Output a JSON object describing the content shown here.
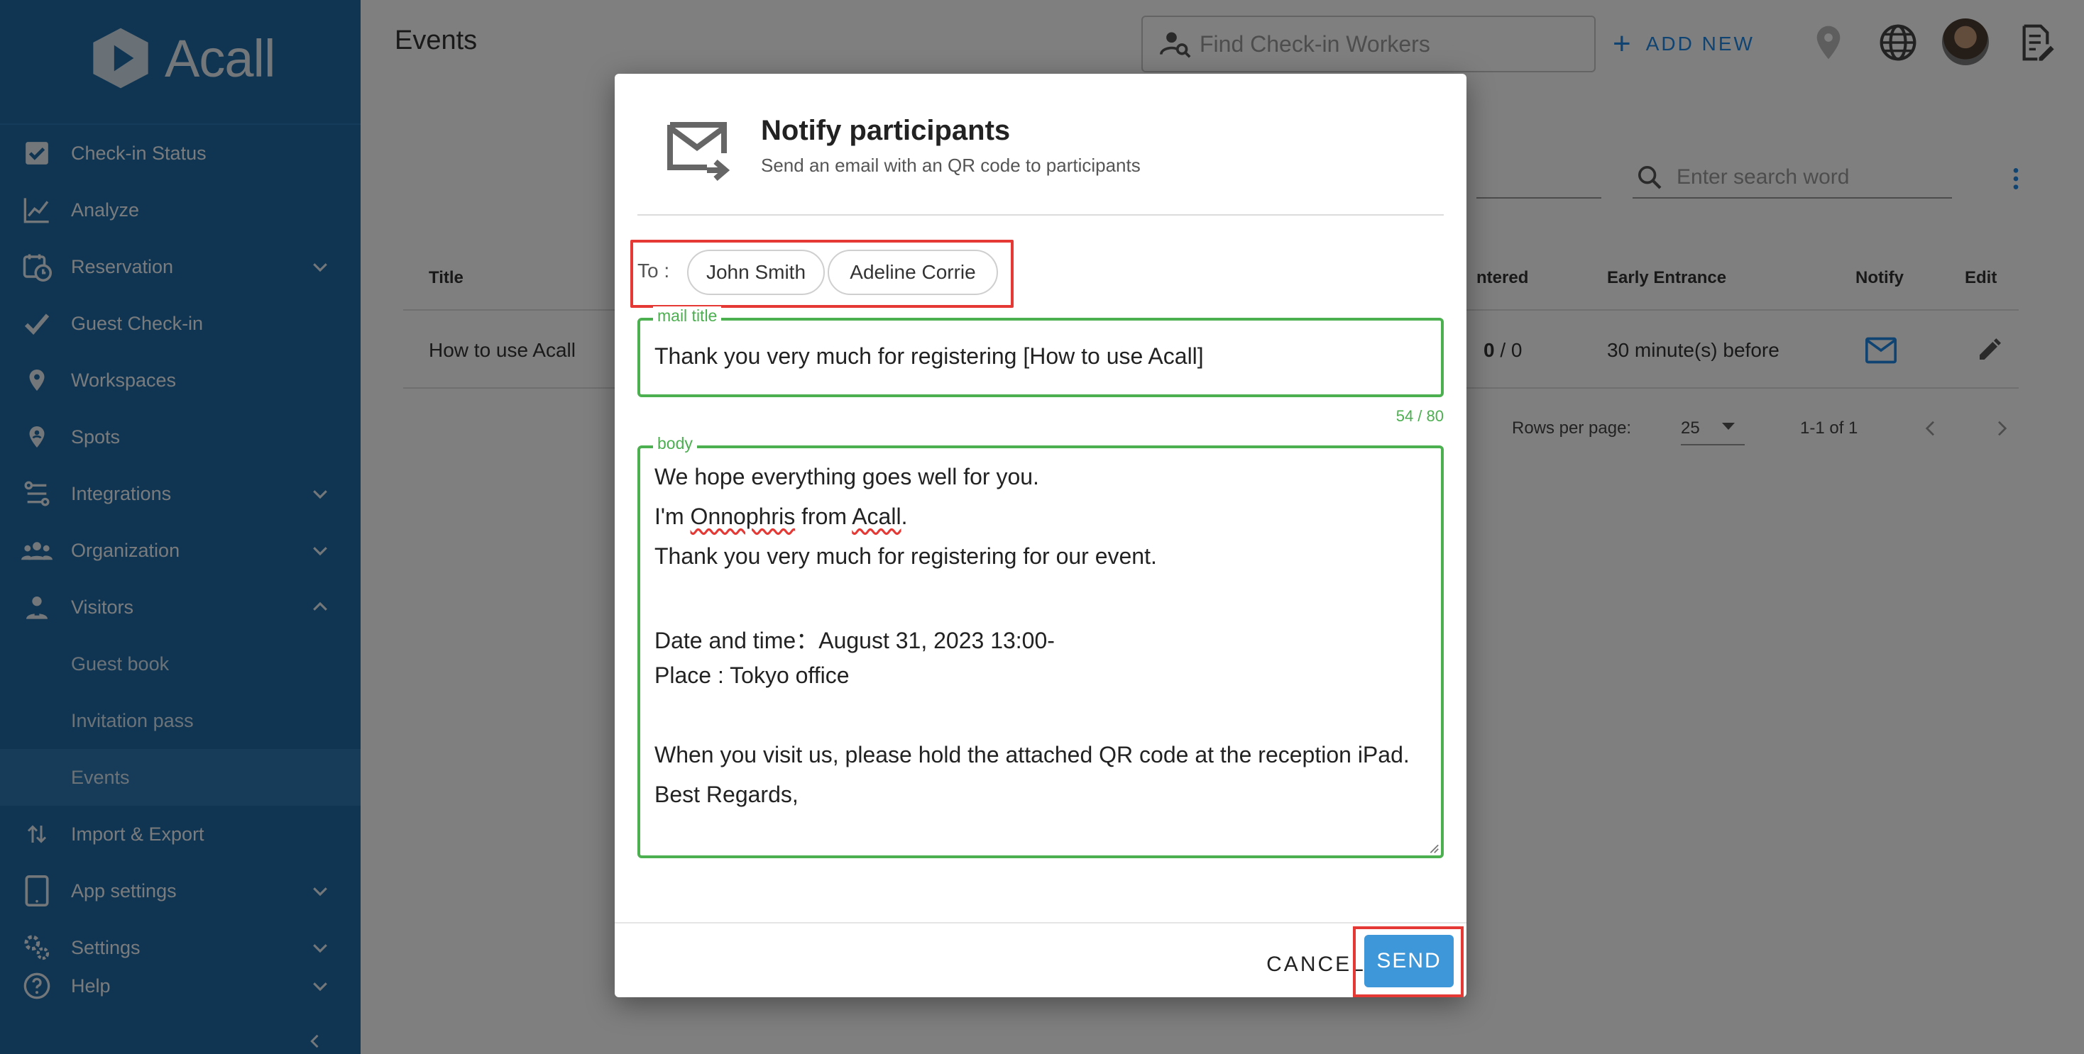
{
  "app": {
    "logo_text": "Acall",
    "page_title": "Events"
  },
  "sidebar": {
    "items": [
      {
        "label": "Check-in Status",
        "icon": "checkbox-icon"
      },
      {
        "label": "Analyze",
        "icon": "chart-line-icon"
      },
      {
        "label": "Reservation",
        "icon": "calendar-clock-icon",
        "expand": "down"
      },
      {
        "label": "Guest Check-in",
        "icon": "check-icon"
      },
      {
        "label": "Workspaces",
        "icon": "map-pin-icon"
      },
      {
        "label": "Spots",
        "icon": "person-pin-icon"
      },
      {
        "label": "Integrations",
        "icon": "integrations-icon",
        "expand": "down"
      },
      {
        "label": "Organization",
        "icon": "people-icon",
        "expand": "down"
      },
      {
        "label": "Visitors",
        "icon": "visitor-icon",
        "expand": "up"
      },
      {
        "label": "Guest book"
      },
      {
        "label": "Invitation pass"
      },
      {
        "label": "Events"
      },
      {
        "label": "Import & Export",
        "icon": "import-export-icon"
      },
      {
        "label": "App settings",
        "icon": "tablet-icon",
        "expand": "down"
      },
      {
        "label": "Settings",
        "icon": "settings-icon",
        "expand": "down"
      },
      {
        "label": "Help",
        "icon": "help-icon",
        "expand": "down"
      }
    ]
  },
  "topbar": {
    "find_placeholder": "Find Check-in Workers",
    "add_new_label": "ADD NEW"
  },
  "table": {
    "search_placeholder": "Enter search word",
    "headers": [
      "Title",
      "ntered",
      "Early Entrance",
      "Notify",
      "Edit"
    ],
    "rows": [
      {
        "title": "How to use Acall",
        "entered_bold": "0",
        "entered_rest": " / 0",
        "early": "30 minute(s) before"
      }
    ],
    "rows_per_page_label": "Rows per page:",
    "rows_per_page_value": "25",
    "range": "1-1 of 1"
  },
  "dialog": {
    "title": "Notify participants",
    "subtitle": "Send an email with an QR code to participants",
    "to_label": "To :",
    "recipients": [
      "John Smith",
      "Adeline Corrie"
    ],
    "mail_title_label": "mail title",
    "mail_title_value": "Thank you very much for registering [How to use Acall]",
    "counter": "54 / 80",
    "body_label": "body",
    "body": {
      "line1": "We hope everything goes well for you.",
      "line2_a": "I'm ",
      "line2_b": "Onnophris",
      "line2_c": " from ",
      "line2_d": "Acall",
      "line2_e": ".",
      "line3": "Thank you very much for registering for our event.",
      "line4": "Date and time：August 31, 2023 13:00-",
      "line5": "Place : Tokyo office",
      "line6": "When you visit us, please hold the attached QR code at the reception iPad.",
      "line7": "Best Regards,"
    },
    "cancel_label": "CANCEL",
    "send_label": "SEND"
  },
  "colors": {
    "sidebar": "#1f6aa5",
    "accent": "#3d97d9",
    "field_border": "#4caf50",
    "highlight": "#e53935"
  }
}
